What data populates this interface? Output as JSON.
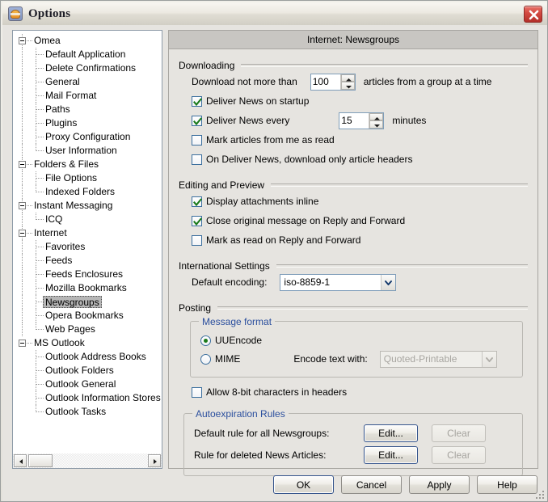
{
  "window": {
    "title": "Options",
    "app_icon": "omea-app-icon",
    "close_label": "Close"
  },
  "tree": {
    "nodes": [
      {
        "label": "Omea",
        "level": 0,
        "expanded": true
      },
      {
        "label": "Default Application",
        "level": 1
      },
      {
        "label": "Delete Confirmations",
        "level": 1
      },
      {
        "label": "General",
        "level": 1
      },
      {
        "label": "Mail Format",
        "level": 1
      },
      {
        "label": "Paths",
        "level": 1
      },
      {
        "label": "Plugins",
        "level": 1
      },
      {
        "label": "Proxy Configuration",
        "level": 1
      },
      {
        "label": "User Information",
        "level": 1
      },
      {
        "label": "Folders & Files",
        "level": 0,
        "expanded": true
      },
      {
        "label": "File Options",
        "level": 1
      },
      {
        "label": "Indexed Folders",
        "level": 1
      },
      {
        "label": "Instant Messaging",
        "level": 0,
        "expanded": true
      },
      {
        "label": "ICQ",
        "level": 1
      },
      {
        "label": "Internet",
        "level": 0,
        "expanded": true
      },
      {
        "label": "Favorites",
        "level": 1
      },
      {
        "label": "Feeds",
        "level": 1
      },
      {
        "label": "Feeds Enclosures",
        "level": 1
      },
      {
        "label": "Mozilla Bookmarks",
        "level": 1
      },
      {
        "label": "Newsgroups",
        "level": 1,
        "selected": true
      },
      {
        "label": "Opera Bookmarks",
        "level": 1
      },
      {
        "label": "Web Pages",
        "level": 1
      },
      {
        "label": "MS Outlook",
        "level": 0,
        "expanded": true
      },
      {
        "label": "Outlook Address Books",
        "level": 1
      },
      {
        "label": "Outlook Folders",
        "level": 1
      },
      {
        "label": "Outlook General",
        "level": 1
      },
      {
        "label": "Outlook Information Stores",
        "level": 1
      },
      {
        "label": "Outlook Tasks",
        "level": 1
      }
    ],
    "hscroll": {
      "left_arrow": "scroll-left",
      "right_arrow": "scroll-right"
    }
  },
  "panel": {
    "header": "Internet: Newsgroups",
    "downloading": {
      "caption": "Downloading",
      "limit_label": "Download not more than",
      "limit_value": "100",
      "limit_suffix": "articles from a group at a time",
      "deliver_on_startup": {
        "label": "Deliver News on startup",
        "checked": true
      },
      "deliver_every": {
        "label": "Deliver News every",
        "checked": true
      },
      "deliver_every_value": "15",
      "deliver_every_suffix": "minutes",
      "mark_from_me": {
        "label": "Mark articles from me as read",
        "checked": false
      },
      "headers_only": {
        "label": "On Deliver News, download only article headers",
        "checked": false
      }
    },
    "editing": {
      "caption": "Editing and Preview",
      "attachments_inline": {
        "label": "Display attachments inline",
        "checked": true
      },
      "close_original": {
        "label": "Close original message on Reply and Forward",
        "checked": true
      },
      "mark_as_read": {
        "label": "Mark as read on Reply and Forward",
        "checked": false
      }
    },
    "international": {
      "caption": "International Settings",
      "encoding_label": "Default encoding:",
      "encoding_value": "iso-8859-1"
    },
    "posting": {
      "caption": "Posting",
      "message_format": {
        "legend": "Message format",
        "uuencode": {
          "label": "UUEncode",
          "selected": true
        },
        "mime": {
          "label": "MIME",
          "selected": false
        },
        "encode_with_label": "Encode text with:",
        "encode_with_value": "Quoted-Printable",
        "encode_with_disabled": true
      },
      "allow_8bit": {
        "label": "Allow 8-bit characters in headers",
        "checked": false
      }
    },
    "autoexpiration": {
      "legend": "Autoexpiration Rules",
      "rows": [
        {
          "label": "Default rule for all Newsgroups:",
          "edit": "Edit...",
          "clear": "Clear",
          "clear_disabled": true
        },
        {
          "label": "Rule for deleted News Articles:",
          "edit": "Edit...",
          "clear": "Clear",
          "clear_disabled": true
        }
      ]
    }
  },
  "footer": {
    "ok": "OK",
    "cancel": "Cancel",
    "apply": "Apply",
    "help": "Help"
  },
  "colors": {
    "legend_blue": "#2b4f9e",
    "checkbox_border": "#3c6f9e",
    "check_green": "#1a7a1a",
    "panel_bg": "#e6e4e0",
    "header_bg": "#c8c6c2",
    "close_red": "#d44b42"
  }
}
